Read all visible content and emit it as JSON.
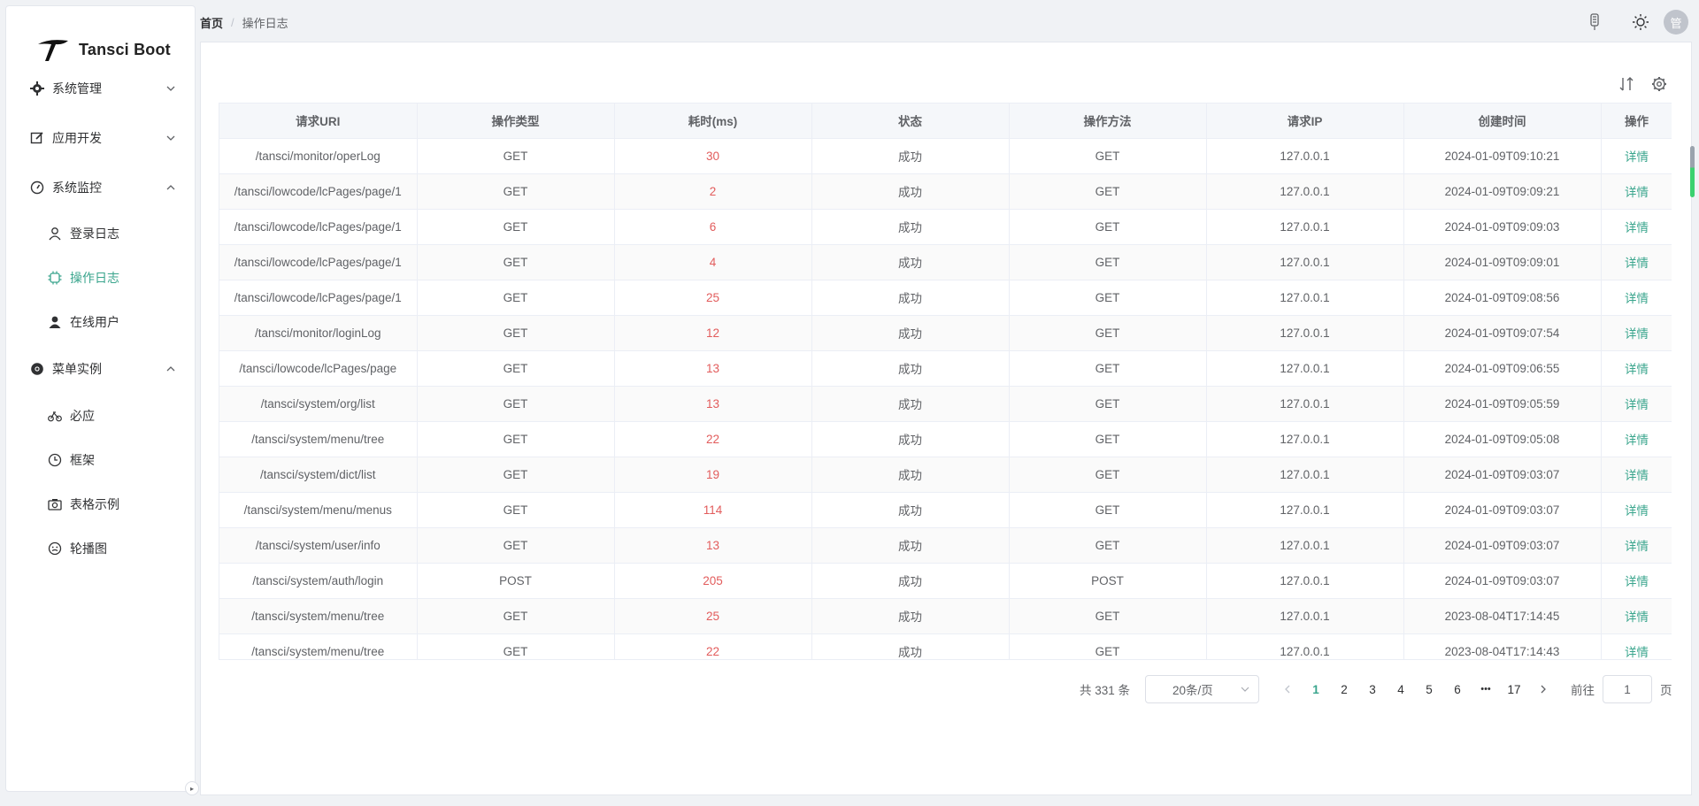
{
  "app": {
    "name": "Tansci Boot"
  },
  "breadcrumb": {
    "home": "首页",
    "separator": "/",
    "current": "操作日志"
  },
  "header": {
    "avatar_text": "管",
    "icons": [
      "mic-icon",
      "sun-icon"
    ]
  },
  "sidebar": {
    "groups": [
      {
        "label": "系统管理",
        "icon": "gear-icon",
        "expanded": false
      },
      {
        "label": "应用开发",
        "icon": "edit-icon",
        "expanded": false
      },
      {
        "label": "系统监控",
        "icon": "gauge-icon",
        "expanded": true,
        "items": [
          {
            "label": "登录日志",
            "icon": "user-icon"
          },
          {
            "label": "操作日志",
            "icon": "cpu-icon",
            "active": true
          },
          {
            "label": "在线用户",
            "icon": "user-filled-icon"
          }
        ]
      },
      {
        "label": "菜单实例",
        "icon": "chrome-icon",
        "expanded": true,
        "items": [
          {
            "label": "必应",
            "icon": "bicycle-icon"
          },
          {
            "label": "框架",
            "icon": "clock-icon"
          },
          {
            "label": "表格示例",
            "icon": "camera-icon"
          },
          {
            "label": "轮播图",
            "icon": "smile-icon"
          }
        ]
      }
    ]
  },
  "toolbar": {
    "icons": [
      "sort-icon",
      "settings-icon"
    ]
  },
  "table": {
    "columns": [
      "请求URI",
      "操作类型",
      "耗时(ms)",
      "状态",
      "操作方法",
      "请求IP",
      "创建时间",
      "操作"
    ],
    "rows": [
      {
        "uri": "/tansci/monitor/operLog",
        "type": "GET",
        "duration": "30",
        "status": "成功",
        "method": "GET",
        "ip": "127.0.0.1",
        "time": "2024-01-09T09:10:21",
        "action": "详情"
      },
      {
        "uri": "/tansci/lowcode/lcPages/page/1",
        "type": "GET",
        "duration": "2",
        "status": "成功",
        "method": "GET",
        "ip": "127.0.0.1",
        "time": "2024-01-09T09:09:21",
        "action": "详情"
      },
      {
        "uri": "/tansci/lowcode/lcPages/page/1",
        "type": "GET",
        "duration": "6",
        "status": "成功",
        "method": "GET",
        "ip": "127.0.0.1",
        "time": "2024-01-09T09:09:03",
        "action": "详情"
      },
      {
        "uri": "/tansci/lowcode/lcPages/page/1",
        "type": "GET",
        "duration": "4",
        "status": "成功",
        "method": "GET",
        "ip": "127.0.0.1",
        "time": "2024-01-09T09:09:01",
        "action": "详情"
      },
      {
        "uri": "/tansci/lowcode/lcPages/page/1",
        "type": "GET",
        "duration": "25",
        "status": "成功",
        "method": "GET",
        "ip": "127.0.0.1",
        "time": "2024-01-09T09:08:56",
        "action": "详情"
      },
      {
        "uri": "/tansci/monitor/loginLog",
        "type": "GET",
        "duration": "12",
        "status": "成功",
        "method": "GET",
        "ip": "127.0.0.1",
        "time": "2024-01-09T09:07:54",
        "action": "详情"
      },
      {
        "uri": "/tansci/lowcode/lcPages/page",
        "type": "GET",
        "duration": "13",
        "status": "成功",
        "method": "GET",
        "ip": "127.0.0.1",
        "time": "2024-01-09T09:06:55",
        "action": "详情"
      },
      {
        "uri": "/tansci/system/org/list",
        "type": "GET",
        "duration": "13",
        "status": "成功",
        "method": "GET",
        "ip": "127.0.0.1",
        "time": "2024-01-09T09:05:59",
        "action": "详情"
      },
      {
        "uri": "/tansci/system/menu/tree",
        "type": "GET",
        "duration": "22",
        "status": "成功",
        "method": "GET",
        "ip": "127.0.0.1",
        "time": "2024-01-09T09:05:08",
        "action": "详情"
      },
      {
        "uri": "/tansci/system/dict/list",
        "type": "GET",
        "duration": "19",
        "status": "成功",
        "method": "GET",
        "ip": "127.0.0.1",
        "time": "2024-01-09T09:03:07",
        "action": "详情"
      },
      {
        "uri": "/tansci/system/menu/menus",
        "type": "GET",
        "duration": "114",
        "status": "成功",
        "method": "GET",
        "ip": "127.0.0.1",
        "time": "2024-01-09T09:03:07",
        "action": "详情"
      },
      {
        "uri": "/tansci/system/user/info",
        "type": "GET",
        "duration": "13",
        "status": "成功",
        "method": "GET",
        "ip": "127.0.0.1",
        "time": "2024-01-09T09:03:07",
        "action": "详情"
      },
      {
        "uri": "/tansci/system/auth/login",
        "type": "POST",
        "duration": "205",
        "status": "成功",
        "method": "POST",
        "ip": "127.0.0.1",
        "time": "2024-01-09T09:03:07",
        "action": "详情"
      },
      {
        "uri": "/tansci/system/menu/tree",
        "type": "GET",
        "duration": "25",
        "status": "成功",
        "method": "GET",
        "ip": "127.0.0.1",
        "time": "2023-08-04T17:14:45",
        "action": "详情"
      },
      {
        "uri": "/tansci/system/menu/tree",
        "type": "GET",
        "duration": "22",
        "status": "成功",
        "method": "GET",
        "ip": "127.0.0.1",
        "time": "2023-08-04T17:14:43",
        "action": "详情"
      }
    ]
  },
  "pagination": {
    "total_text": "共 331 条",
    "page_size": "20条/页",
    "pages": [
      "1",
      "2",
      "3",
      "4",
      "5",
      "6"
    ],
    "ellipsis": "•••",
    "last_page": "17",
    "current_page": "1",
    "goto_label": "前往",
    "goto_value": "1",
    "goto_suffix": "页"
  },
  "colors": {
    "accent": "#3aa58d",
    "duration": "#e25c5c",
    "header_bg": "#f5f7fa"
  }
}
